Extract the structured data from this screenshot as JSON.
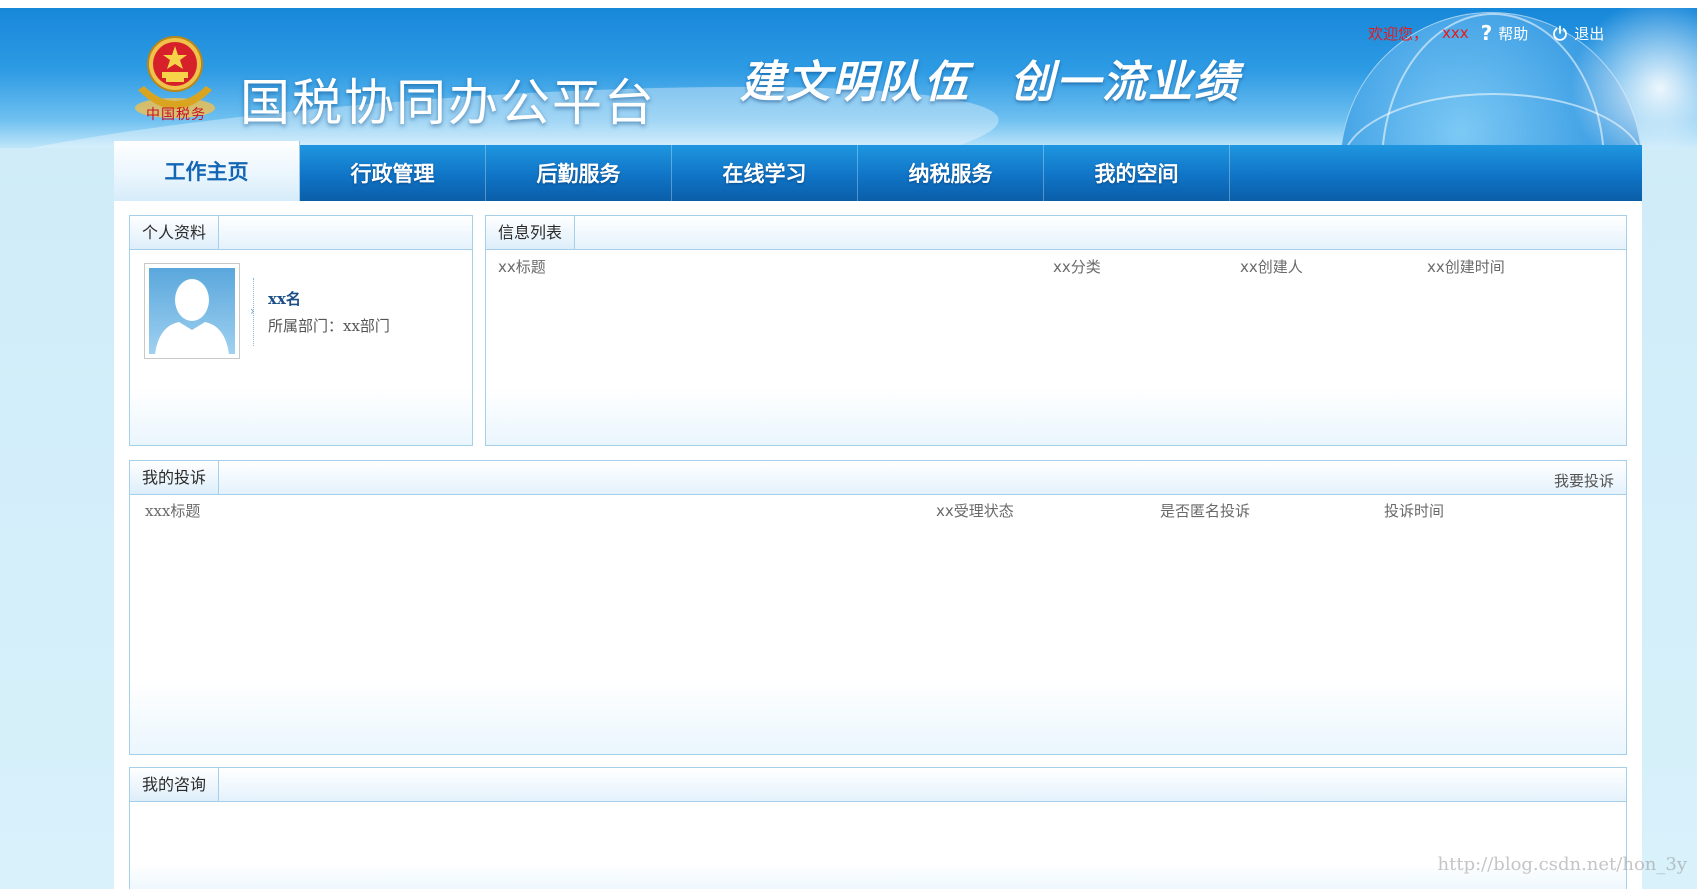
{
  "header": {
    "emblem_caption": "中国税务",
    "system_title": "国税协同办公平台",
    "slogan_left": "建文明队伍",
    "slogan_right": "创一流业绩",
    "user_bar": {
      "welcome": "欢迎您，",
      "username": "xxx",
      "help_label": "帮助",
      "logout_label": "退出"
    }
  },
  "nav": {
    "items": [
      {
        "label": "工作主页",
        "active": true
      },
      {
        "label": "行政管理"
      },
      {
        "label": "后勤服务"
      },
      {
        "label": "在线学习"
      },
      {
        "label": "纳税服务"
      },
      {
        "label": "我的空间"
      }
    ]
  },
  "profile_panel": {
    "title": "个人资料",
    "name": "xx名",
    "department": "所属部门：xx部门"
  },
  "info_panel": {
    "title": "信息列表",
    "columns": [
      "xx标题",
      "xx分类",
      "xx创建人",
      "xx创建时间"
    ]
  },
  "complaint_panel": {
    "title": "我的投诉",
    "action_label": "我要投诉",
    "columns": [
      "xxx标题",
      "xx受理状态",
      "是否匿名投诉",
      "投诉时间"
    ]
  },
  "consult_panel": {
    "title": "我的咨询"
  },
  "watermark": "http://blog.csdn.net/hon_3y",
  "colors": {
    "nav_blue": "#1074c6",
    "active_tab_text": "#1366b4",
    "welcome_red": "#e8191a",
    "panel_border": "#a6cfea"
  }
}
